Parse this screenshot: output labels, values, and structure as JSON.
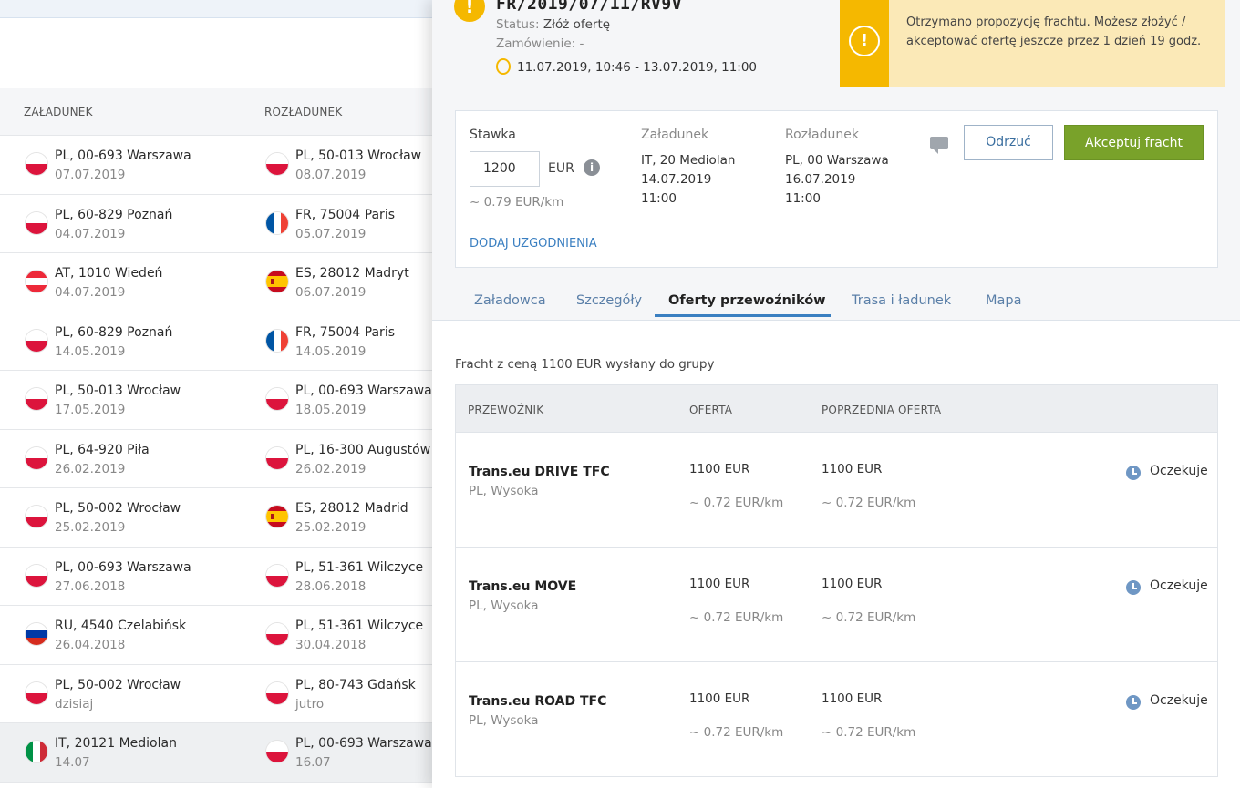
{
  "left_list": {
    "headers": {
      "loading": "ZAŁADUNEK",
      "unloading": "ROZŁADUNEK"
    },
    "rows": [
      {
        "from_flag": "pl",
        "from": "PL, 00-693 Warszawa",
        "from_date": "07.07.2019",
        "to_flag": "pl",
        "to": "PL, 50-013 Wrocław",
        "to_date": "08.07.2019"
      },
      {
        "from_flag": "pl",
        "from": "PL, 60-829 Poznań",
        "from_date": "04.07.2019",
        "to_flag": "fr",
        "to": "FR, 75004 Paris",
        "to_date": "05.07.2019"
      },
      {
        "from_flag": "at",
        "from": "AT, 1010 Wiedeń",
        "from_date": "04.07.2019",
        "to_flag": "es",
        "to": "ES, 28012 Madryt",
        "to_date": "06.07.2019"
      },
      {
        "from_flag": "pl",
        "from": "PL, 60-829 Poznań",
        "from_date": "14.05.2019",
        "to_flag": "fr",
        "to": "FR, 75004 Paris",
        "to_date": "14.05.2019"
      },
      {
        "from_flag": "pl",
        "from": "PL, 50-013 Wrocław",
        "from_date": "17.05.2019",
        "to_flag": "pl",
        "to": "PL, 00-693 Warszawa",
        "to_date": "18.05.2019"
      },
      {
        "from_flag": "pl",
        "from": "PL, 64-920 Piła",
        "from_date": "26.02.2019",
        "to_flag": "pl",
        "to": "PL, 16-300 Augustów",
        "to_date": "26.02.2019"
      },
      {
        "from_flag": "pl",
        "from": "PL, 50-002 Wrocław",
        "from_date": "25.02.2019",
        "to_flag": "es",
        "to": "ES, 28012 Madrid",
        "to_date": "25.02.2019"
      },
      {
        "from_flag": "pl",
        "from": "PL, 00-693 Warszawa",
        "from_date": "27.06.2018",
        "to_flag": "pl",
        "to": "PL, 51-361 Wilczyce",
        "to_date": "28.06.2018"
      },
      {
        "from_flag": "ru",
        "from": "RU, 4540 Czelabińsk",
        "from_date": "26.04.2018",
        "to_flag": "pl",
        "to": "PL, 51-361 Wilczyce",
        "to_date": "30.04.2018"
      },
      {
        "from_flag": "pl",
        "from": "PL, 50-002 Wrocław",
        "from_date": "dzisiaj",
        "to_flag": "pl",
        "to": "PL, 80-743 Gdańsk",
        "to_date": "jutro"
      },
      {
        "from_flag": "it",
        "from": "IT, 20121 Mediolan",
        "from_date": "14.07",
        "to_flag": "pl",
        "to": "PL, 00-693 Warszawa",
        "to_date": "16.07",
        "selected": true
      }
    ]
  },
  "freight": {
    "id": "FR/2019/07/11/RV9V",
    "status_label": "Status:",
    "status_value": "Złóż ofertę",
    "order_label": "Zamówienie:",
    "order_value": "-",
    "time_range": "11.07.2019, 10:46 - 13.07.2019, 11:00"
  },
  "alert": {
    "message": "Otrzymano propozycję frachtu. Możesz złożyć / akceptować ofertę jeszcze przez 1 dzień 19 godz."
  },
  "offer_card": {
    "rate_label": "Stawka",
    "rate_value": "1200",
    "currency": "EUR",
    "per_km": "~ 0.79 EUR/km",
    "add_link": "DODAJ UZGODNIENIA",
    "loading_label": "Załadunek",
    "loading_place": "IT, 20 Mediolan",
    "loading_date": "14.07.2019",
    "loading_time": "11:00",
    "unloading_label": "Rozładunek",
    "unloading_place": "PL, 00 Warszawa",
    "unloading_date": "16.07.2019",
    "unloading_time": "11:00",
    "reject_label": "Odrzuć",
    "accept_label": "Akceptuj fracht"
  },
  "tabs": [
    "Załadowca",
    "Szczegóły",
    "Oferty przewoźników",
    "Trasa i ładunek",
    "Mapa"
  ],
  "active_tab": "Oferty przewoźników",
  "offers": {
    "sent_text": "Fracht z ceną 1100 EUR wysłany do grupy",
    "headers": {
      "carrier": "PRZEWOŹNIK",
      "offer": "OFERTA",
      "previous": "POPRZEDNIA OFERTA"
    },
    "rows": [
      {
        "carrier": "Trans.eu DRIVE TFC",
        "location": "PL, Wysoka",
        "offer": "1100  EUR",
        "offer_km": "~ 0.72  EUR/km",
        "prev": "1100  EUR",
        "prev_km": "~ 0.72  EUR/km",
        "status": "Oczekuje"
      },
      {
        "carrier": "Trans.eu MOVE",
        "location": "PL, Wysoka",
        "offer": "1100  EUR",
        "offer_km": "~ 0.72  EUR/km",
        "prev": "1100  EUR",
        "prev_km": "~ 0.72  EUR/km",
        "status": "Oczekuje"
      },
      {
        "carrier": "Trans.eu ROAD TFC",
        "location": "PL, Wysoka",
        "offer": "1100  EUR",
        "offer_km": "~ 0.72  EUR/km",
        "prev": "1100  EUR",
        "prev_km": "~ 0.72  EUR/km",
        "status": "Oczekuje"
      }
    ]
  },
  "colors": {
    "accent": "#3a7fc1",
    "warning": "#f5b800",
    "accept": "#79a22a"
  }
}
